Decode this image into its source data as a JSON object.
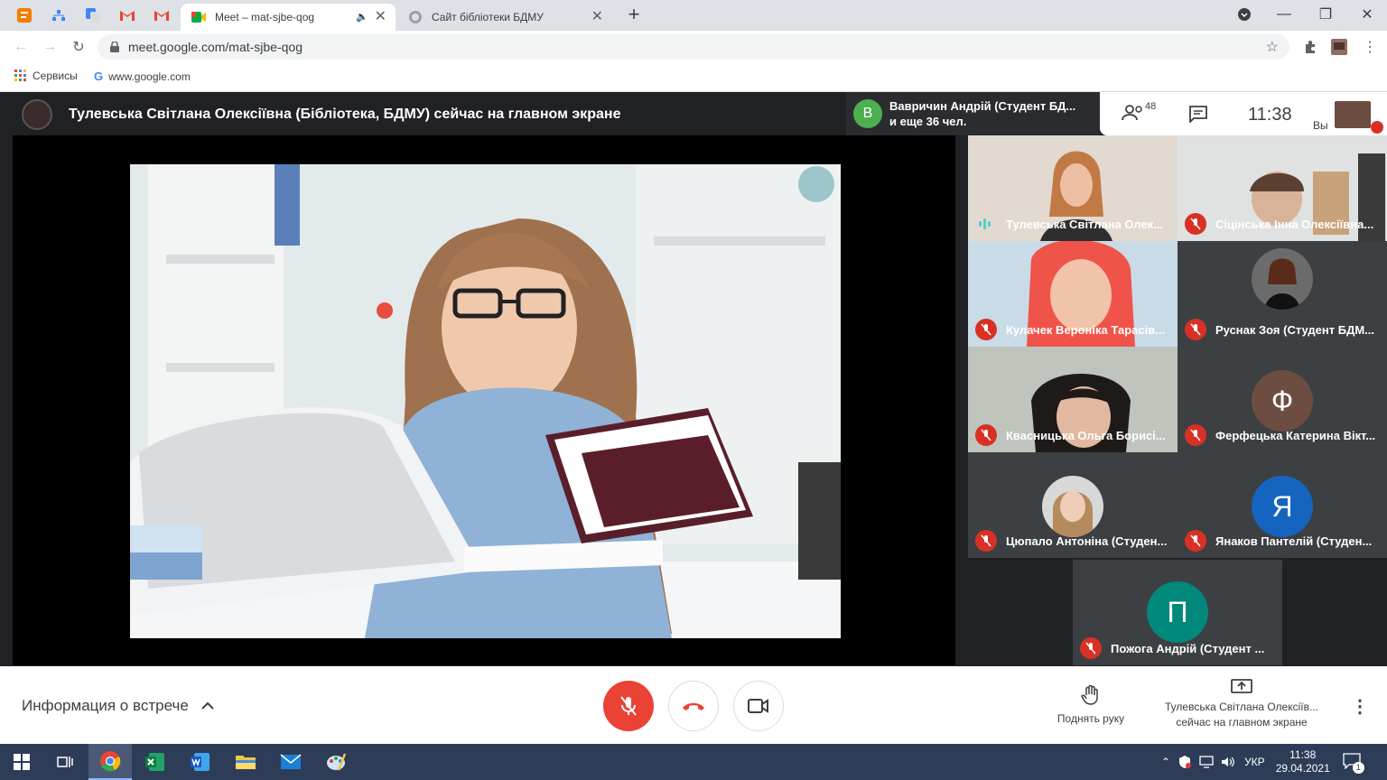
{
  "browser": {
    "tabs": [
      {
        "label": "Meet – mat-sjbe-qog",
        "active": true
      },
      {
        "label": "Сайт бібліотеки БДМУ",
        "active": false
      }
    ],
    "url": "meet.google.com/mat-sjbe-qog",
    "bookmarks": [
      {
        "label": "Сервисы",
        "icon": "apps-grid-icon"
      },
      {
        "label": "www.google.com",
        "icon": "google-g-icon"
      }
    ]
  },
  "meeting": {
    "presenter_banner": "Тулевська Світлана Олексіївна (Бібліотека, БДМУ) сейчас на главном экране",
    "join_notice": {
      "initial": "В",
      "line1": "Вавричин Андрій (Студент БД...",
      "line2": "и еще 36 чел."
    },
    "participants_count": "48",
    "clock": "11:38",
    "self_label": "Вы",
    "participants": [
      {
        "name": "Тулевська Світлана Олек...",
        "status": "speaking",
        "kind": "video",
        "avatar": ""
      },
      {
        "name": "Сіцінська Інна Олексіївна...",
        "status": "muted",
        "kind": "video",
        "avatar": ""
      },
      {
        "name": "Кулачек Вероніка Тарасів...",
        "status": "muted",
        "kind": "video",
        "avatar": ""
      },
      {
        "name": "Руснак Зоя (Студент БДМ...",
        "status": "muted",
        "kind": "photo",
        "avatar": ""
      },
      {
        "name": "Квасницька Ольга Борисі...",
        "status": "muted",
        "kind": "video",
        "avatar": ""
      },
      {
        "name": "Ферфецька Катерина Вікт...",
        "status": "muted",
        "kind": "letter",
        "avatar": "Ф",
        "color": "#6d4c41"
      },
      {
        "name": "Цюпало Антоніна (Студен...",
        "status": "muted",
        "kind": "photo",
        "avatar": ""
      },
      {
        "name": "Янаков Пантелій (Студен...",
        "status": "muted",
        "kind": "letter",
        "avatar": "Я",
        "color": "#1565c0"
      },
      {
        "name": "Пожога Андрій (Студент ...",
        "status": "muted",
        "kind": "letter",
        "avatar": "П",
        "color": "#00897b"
      }
    ]
  },
  "controls": {
    "meeting_info": "Информация о встрече",
    "raise_hand": "Поднять руку",
    "presenting_line1": "Тулевська Світлана Олексіїв...",
    "presenting_line2": "сейчас на главном экране"
  },
  "taskbar": {
    "language": "УКР",
    "time": "11:38",
    "date": "29.04.2021",
    "notifications": "1"
  },
  "colors": {
    "meet_red": "#ea4335",
    "meet_dark": "#202124",
    "taskbar": "#2d3d57"
  }
}
